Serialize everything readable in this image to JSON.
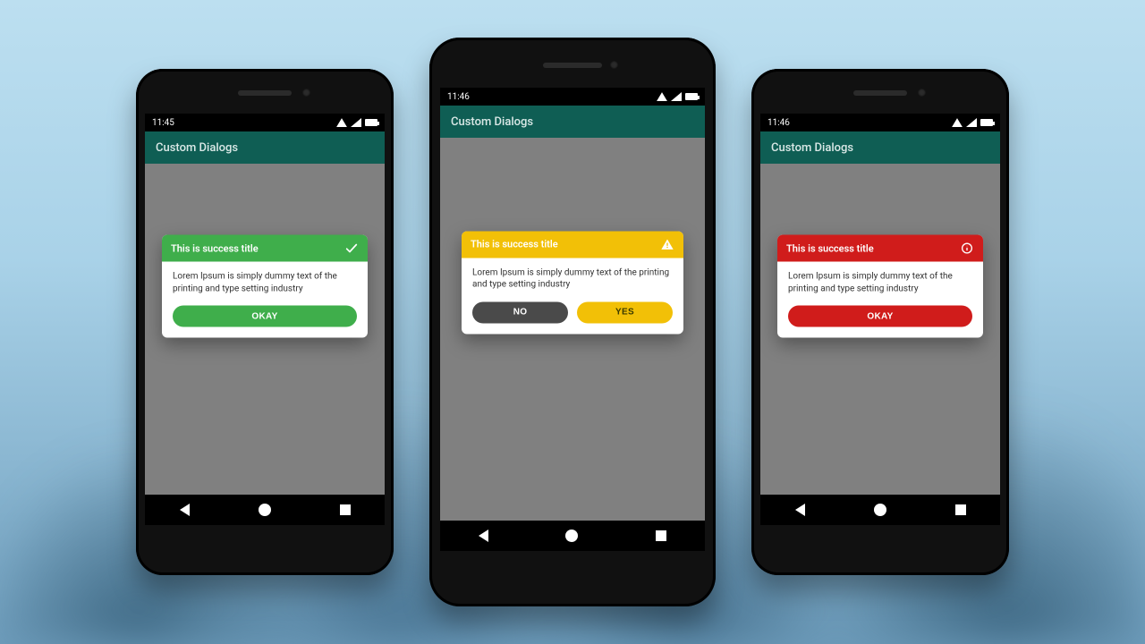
{
  "phones": [
    {
      "status_time": "11:45",
      "app_title": "Custom Dialogs",
      "dialog": {
        "title": "This is success title",
        "body": "Lorem Ipsum is simply dummy text of the printing and type setting industry",
        "icon": "check-icon",
        "primary_label": "OKAY"
      }
    },
    {
      "status_time": "11:46",
      "app_title": "Custom Dialogs",
      "dialog": {
        "title": "This is success title",
        "body": "Lorem Ipsum is simply dummy text of the printing and type setting industry",
        "icon": "warning-icon",
        "negative_label": "NO",
        "positive_label": "YES"
      }
    },
    {
      "status_time": "11:46",
      "app_title": "Custom Dialogs",
      "dialog": {
        "title": "This is success title",
        "body": "Lorem Ipsum is simply dummy text of the printing and type setting industry",
        "icon": "info-icon",
        "primary_label": "OKAY"
      }
    }
  ],
  "colors": {
    "success": "#3fae4b",
    "warning": "#f2c007",
    "error": "#d01c1b",
    "appbar": "#0f5e54"
  }
}
